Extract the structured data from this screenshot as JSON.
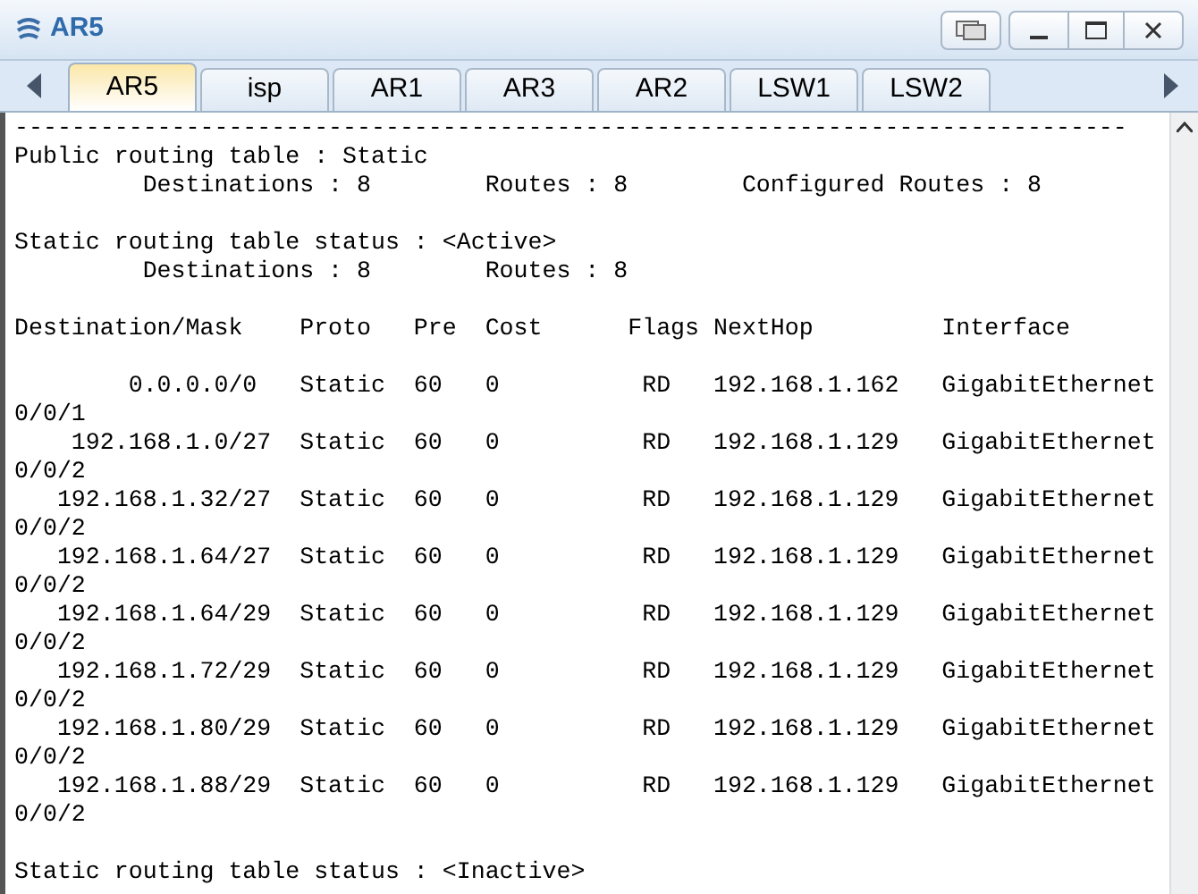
{
  "window": {
    "title": "AR5"
  },
  "tabs": [
    {
      "label": "AR5",
      "selected": true
    },
    {
      "label": "isp",
      "selected": false
    },
    {
      "label": "AR1",
      "selected": false
    },
    {
      "label": "AR3",
      "selected": false
    },
    {
      "label": "AR2",
      "selected": false
    },
    {
      "label": "LSW1",
      "selected": false
    },
    {
      "label": "LSW2",
      "selected": false
    }
  ],
  "terminal": {
    "lines": [
      {
        "kind": "text",
        "text": "------------------------------------------------------------------------------"
      },
      {
        "kind": "text",
        "text": "Public routing table : Static"
      },
      {
        "kind": "text",
        "text": "         Destinations : 8        Routes : 8        Configured Routes : 8"
      },
      {
        "kind": "blank"
      },
      {
        "kind": "text",
        "text": "Static routing table status : <Active>"
      },
      {
        "kind": "text",
        "text": "         Destinations : 8        Routes : 8"
      },
      {
        "kind": "blank"
      },
      {
        "kind": "text",
        "text": "Destination/Mask    Proto   Pre  Cost      Flags NextHop         Interface"
      },
      {
        "kind": "blank"
      },
      {
        "kind": "text",
        "text": "        0.0.0.0/0   Static  60   0          RD   192.168.1.162   GigabitEthernet"
      },
      {
        "kind": "text",
        "text": "0/0/1"
      },
      {
        "kind": "text",
        "text": "    192.168.1.0/27  Static  60   0          RD   192.168.1.129   GigabitEthernet"
      },
      {
        "kind": "text",
        "text": "0/0/2"
      },
      {
        "kind": "text",
        "text": "   192.168.1.32/27  Static  60   0          RD   192.168.1.129   GigabitEthernet"
      },
      {
        "kind": "text",
        "text": "0/0/2"
      },
      {
        "kind": "text",
        "text": "   192.168.1.64/27  Static  60   0          RD   192.168.1.129   GigabitEthernet"
      },
      {
        "kind": "text",
        "text": "0/0/2"
      },
      {
        "kind": "text",
        "text": "   192.168.1.64/29  Static  60   0          RD   192.168.1.129   GigabitEthernet"
      },
      {
        "kind": "text",
        "text": "0/0/2"
      },
      {
        "kind": "text",
        "text": "   192.168.1.72/29  Static  60   0          RD   192.168.1.129   GigabitEthernet"
      },
      {
        "kind": "text",
        "text": "0/0/2"
      },
      {
        "kind": "text",
        "text": "   192.168.1.80/29  Static  60   0          RD   192.168.1.129   GigabitEthernet"
      },
      {
        "kind": "text",
        "text": "0/0/2"
      },
      {
        "kind": "text",
        "text": "   192.168.1.88/29  Static  60   0          RD   192.168.1.129   GigabitEthernet"
      },
      {
        "kind": "text",
        "text": "0/0/2"
      },
      {
        "kind": "blank"
      },
      {
        "kind": "text",
        "text": "Static routing table status : <Inactive>"
      }
    ]
  }
}
